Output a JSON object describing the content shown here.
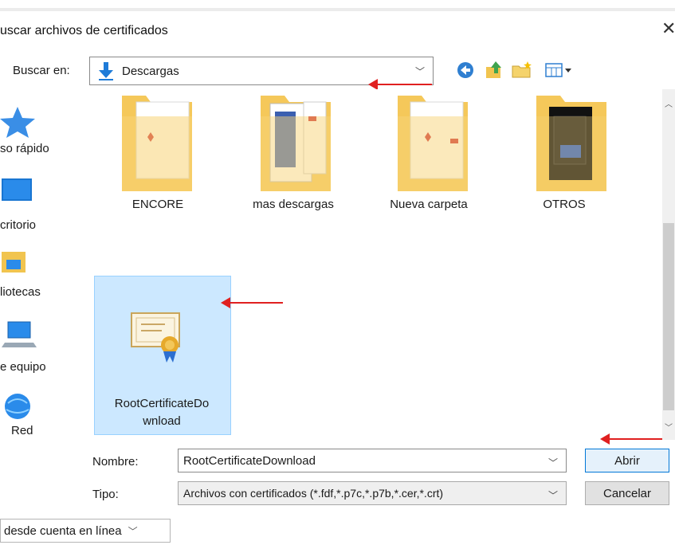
{
  "dialog": {
    "title": "uscar archivos de certificados",
    "close_glyph": "✕"
  },
  "lookin": {
    "label": "Buscar en:",
    "value": "Descargas",
    "icon": "download-arrow-icon"
  },
  "toolbar": {
    "icons": [
      "back-icon",
      "up-folder-icon",
      "new-folder-icon",
      "view-menu-icon"
    ]
  },
  "sidebar": {
    "items": [
      {
        "label": "so rápido",
        "icon": "quick-access-star-icon"
      },
      {
        "label": "critorio",
        "icon": "desktop-icon"
      },
      {
        "label": "liotecas",
        "icon": "libraries-icon"
      },
      {
        "label": "e equipo",
        "icon": "computer-icon"
      },
      {
        "label": "Red",
        "icon": "network-icon"
      }
    ]
  },
  "files": [
    {
      "name": "ENCORE",
      "type": "folder"
    },
    {
      "name": "mas descargas",
      "type": "folder"
    },
    {
      "name": "Nueva carpeta",
      "type": "folder"
    },
    {
      "name": "OTROS",
      "type": "folder"
    },
    {
      "name": "RootCertificateDo",
      "name2": "wnload",
      "type": "certificate",
      "selected": true
    }
  ],
  "filename": {
    "label": "Nombre:",
    "value": "RootCertificateDownload"
  },
  "filetype": {
    "label": "Tipo:",
    "value": "Archivos con certificados (*.fdf,*.p7c,*.p7b,*.cer,*.crt)"
  },
  "buttons": {
    "open": "Abrir",
    "cancel": "Cancelar"
  },
  "account": {
    "label": "desde cuenta en línea"
  },
  "colors": {
    "selection": "#cce8ff",
    "annotation_arrow": "#e02020",
    "folder": "#f5c85a"
  }
}
